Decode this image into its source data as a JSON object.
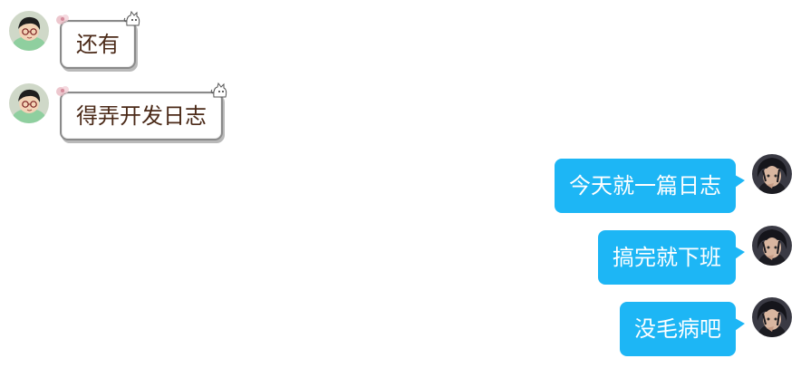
{
  "messages": [
    {
      "side": "left",
      "text": "还有",
      "avatar": "cartoon-avatar-icon"
    },
    {
      "side": "left",
      "text": "得弄开发日志",
      "avatar": "cartoon-avatar-icon"
    },
    {
      "side": "right",
      "text": "今天就一篇日志",
      "avatar": "anime-avatar-icon"
    },
    {
      "side": "right",
      "text": "搞完就下班",
      "avatar": "anime-avatar-icon"
    },
    {
      "side": "right",
      "text": "没毛病吧",
      "avatar": "anime-avatar-icon"
    }
  ],
  "colors": {
    "right_bubble": "#1db6f5",
    "left_text": "#4b2a18",
    "left_border": "#8a8a8a"
  }
}
